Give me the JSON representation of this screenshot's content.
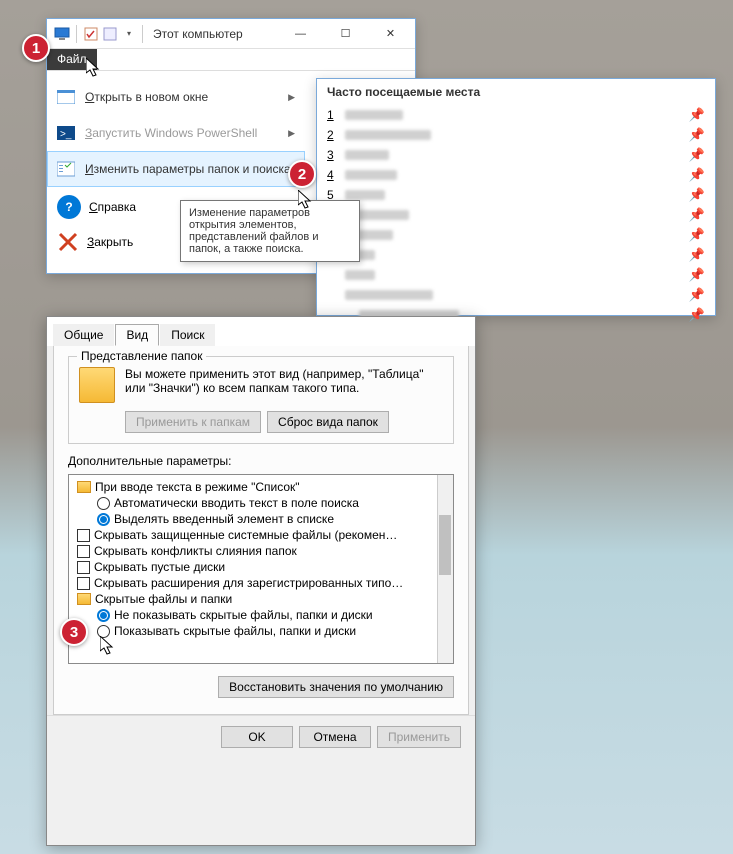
{
  "explorer": {
    "title": "Этот компьютер",
    "ribbon_tab": "Файл",
    "menu": {
      "open_new": "Открыть в новом окне",
      "powershell": "Запустить Windows PowerShell",
      "change_opts": "Изменить параметры папок и поиска",
      "help": "Справка",
      "close": "Закрыть"
    },
    "tooltip": "Изменение параметров открытия элементов, представлений файлов и папок, а также поиска."
  },
  "frequent": {
    "title": "Часто посещаемые места",
    "items": [
      "1",
      "2",
      "3",
      "4",
      "5",
      "",
      "",
      "",
      "",
      "",
      ""
    ]
  },
  "folder_options": {
    "tabs": {
      "general": "Общие",
      "view": "Вид",
      "search": "Поиск"
    },
    "group1_label": "Представление папок",
    "group1_desc": "Вы можете применить этот вид (например, \"Таблица\" или \"Значки\") ко всем папкам такого типа.",
    "apply_folders": "Применить к папкам",
    "reset_folders": "Сброс вида папок",
    "extra_label": "Дополнительные параметры:",
    "tree": {
      "n1": "При вводе текста в режиме \"Список\"",
      "r1": "Автоматически вводить текст в поле поиска",
      "r2": "Выделять введенный элемент в списке",
      "c1": "Скрывать защищенные системные файлы (рекомен…",
      "c2": "Скрывать конфликты слияния папок",
      "c3": "Скрывать пустые диски",
      "c4": "Скрывать расширения для зарегистрированных типо…",
      "n2": "Скрытые файлы и папки",
      "r3": "Не показывать скрытые файлы, папки и диски",
      "r4": "Показывать скрытые файлы, папки и диски"
    },
    "restore": "Восстановить значения по умолчанию",
    "ok": "OK",
    "cancel": "Отмена",
    "apply": "Применить"
  }
}
